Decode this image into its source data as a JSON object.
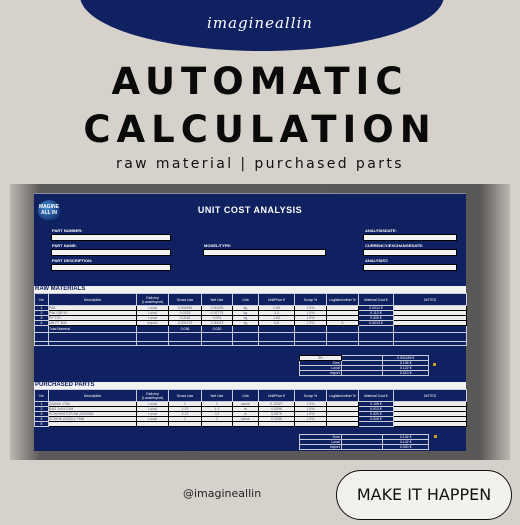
{
  "header": {
    "brand": "imagineallin",
    "title_line1": "AUTOMATIC",
    "title_line2": "CALCULATION",
    "subtitle": "raw material | purchased parts"
  },
  "sheet": {
    "logo_text": "MAGINE ALL IN",
    "title": "UNIT COST ANALYSIS",
    "fields": {
      "part_number": {
        "label": "PART NUMBER:",
        "value": ""
      },
      "part_name": {
        "label": "PART NAME:",
        "value": ""
      },
      "part_description": {
        "label": "PART DESCRIPTION:",
        "value": ""
      },
      "model_type": {
        "label": "MODEL/TYPE:",
        "value": ""
      },
      "analysis_date": {
        "label": "ANALYSISDATE:",
        "value": ""
      },
      "currency_exchange_date": {
        "label": "CURRENCY/EXCHANGEDATE:",
        "value": ""
      },
      "analyst": {
        "label": "ANALYSIST:",
        "value": ""
      }
    },
    "columns": [
      "No",
      "Description",
      "Delivery (Local/Import)",
      "Gross Use",
      "Net Use",
      "Unit",
      "UnitPrice €",
      "Scrap %",
      "Logistics/other %",
      "Material Cost €",
      "NOTES"
    ],
    "raw_materials": {
      "section_title": "RAW MATERIALS",
      "rows": [
        {
          "no": "1",
          "description": "PA6",
          "delivery": "Local",
          "gross_use": "0.000456",
          "net_use": "0.00028",
          "unit": "kg",
          "unit_price": "2.65",
          "scrap": "1.5%",
          "logistics": "",
          "material_cost": "0.0012 €",
          "notes": ""
        },
        {
          "no": "2",
          "description": "PA6 GBF30",
          "delivery": "Local",
          "gross_use": "0.0333",
          "net_use": "0.02775",
          "unit": "kg",
          "unit_price": "3.3",
          "scrap": "1.5%",
          "logistics": "",
          "material_cost": "0.112 €",
          "notes": ""
        },
        {
          "no": "3",
          "description": "PP T20",
          "delivery": "Local",
          "gross_use": "0.0018",
          "net_use": "0.001",
          "unit": "kg",
          "unit_price": "1.63",
          "scrap": "1.5%",
          "logistics": "",
          "material_cost": "0.009 €",
          "notes": ""
        },
        {
          "no": "4",
          "description": "MB PT 808",
          "delivery": "Import",
          "gross_use": "0.000276",
          "net_use": "0.00023",
          "unit": "kg",
          "unit_price": "6.8",
          "scrap": "1.5%",
          "logistics": "6",
          "material_cost": "0.0013 €",
          "notes": ""
        }
      ],
      "total_label": "Total Material",
      "total_gross": "0.036",
      "total_net": "0.032",
      "summary": {
        "percent_input": "3%",
        "percent_value": "0.001165 €",
        "sum_label": "Sum",
        "sum_value": "0.136 €",
        "local_label": "Local",
        "local_value": "0.122 €",
        "import_label": "Import",
        "import_value": "0.013 €"
      }
    },
    "purchased_parts": {
      "section_title": "PURCHASED PARTS",
      "rows": [
        {
          "no": "1",
          "description": "ZAMAK 1750",
          "delivery": "Local",
          "gross_use": "1",
          "net_use": "1",
          "unit": "piece",
          "unit_price": "0.10327",
          "scrap": "1.5%",
          "logistics": "",
          "material_cost": "0.105 €",
          "notes": ""
        },
        {
          "no": "2",
          "description": "BAG 2x0X2.5M",
          "delivery": "Local",
          "gross_use": "1.22",
          "net_use": "1.2",
          "unit": "m",
          "unit_price": "0.0096",
          "scrap": "1.5%",
          "logistics": "",
          "material_cost": "0.012 €",
          "notes": ""
        },
        {
          "no": "3",
          "description": "SCREW/STOP/AB 2900/580",
          "delivery": "Local",
          "gross_use": "0.22",
          "net_use": "0.2",
          "unit": "m",
          "unit_price": "0.0879",
          "scrap": "1.5%",
          "logistics": "",
          "material_cost": "0.020 €",
          "notes": ""
        },
        {
          "no": "4",
          "description": "SCREW (3X810) YMB",
          "delivery": "Local",
          "gross_use": "1",
          "net_use": "1",
          "unit": "piece",
          "unit_price": "0.0056",
          "scrap": "1.5%",
          "logistics": "",
          "material_cost": "0.006 €",
          "notes": ""
        },
        {
          "no": "5",
          "description": "",
          "delivery": "",
          "gross_use": "",
          "net_use": "",
          "unit": "",
          "unit_price": "",
          "scrap": "",
          "logistics": "",
          "material_cost": "",
          "notes": ""
        }
      ],
      "summary": {
        "sum_label": "Sum",
        "sum_value": "0.142 €",
        "local_label": "Local",
        "local_value": "0.142 €",
        "import_label": "Import",
        "import_value": "0.000 €"
      }
    }
  },
  "footer": {
    "handle": "@imagineallin",
    "cta_label": "MAKE IT HAPPEN"
  },
  "colors": {
    "navy": "#0f2160",
    "background": "#d6d1cb",
    "cell": "#ededed",
    "warning": "#c9a017"
  }
}
